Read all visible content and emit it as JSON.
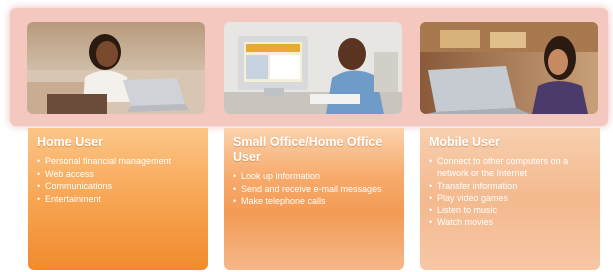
{
  "categories": [
    {
      "title": "Home User",
      "items": [
        "Personal financial management",
        "Web access",
        "Communications",
        "Entertainment"
      ],
      "photo": "woman-with-laptop-on-couch"
    },
    {
      "title": "Small Office/Home Office User",
      "items": [
        "Look up information",
        "Send and receive e-mail messages",
        "Make telephone calls"
      ],
      "photo": "man-at-desktop-computer"
    },
    {
      "title": "Mobile User",
      "items": [
        "Connect to other computers on a network or the Internet",
        "Transfer information",
        "Play video games",
        "Listen to music",
        "Watch movies"
      ],
      "photo": "woman-with-laptop-in-cafe"
    }
  ],
  "colors": {
    "band": "#f4c8bf",
    "card_home": "#f18b2e",
    "card_office": "#f39b55",
    "card_mobile": "#f4b98e",
    "text": "#ffffff"
  }
}
